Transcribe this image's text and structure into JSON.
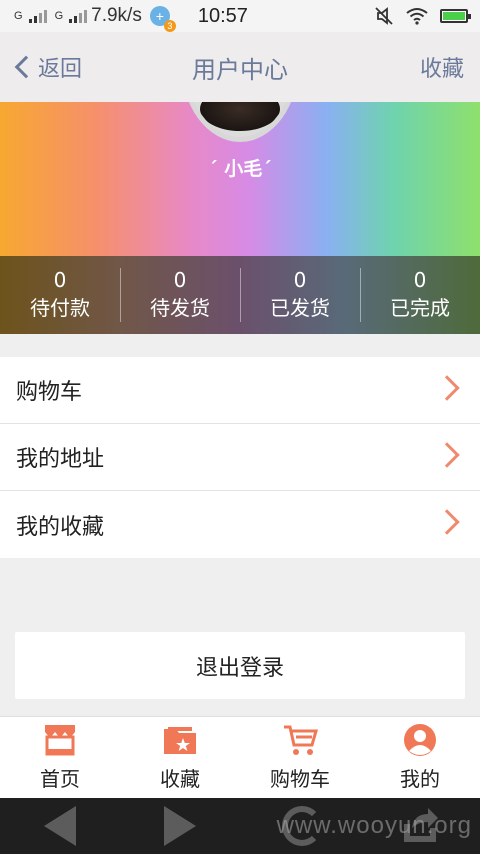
{
  "status_bar": {
    "sim1_label": "G",
    "sim2_label": "G",
    "net_speed": "7.9k/s",
    "qq_badge_count": "3",
    "time": "10:57"
  },
  "header": {
    "back_label": "返回",
    "title": "用户中心",
    "favorite_label": "收藏"
  },
  "profile": {
    "username": "´ 小毛´"
  },
  "order_stats": [
    {
      "count": "0",
      "label": "待付款"
    },
    {
      "count": "0",
      "label": "待发货"
    },
    {
      "count": "0",
      "label": "已发货"
    },
    {
      "count": "0",
      "label": "已完成"
    }
  ],
  "menu": [
    {
      "label": "购物车"
    },
    {
      "label": "我的地址"
    },
    {
      "label": "我的收藏"
    }
  ],
  "logout_label": "退出登录",
  "tabs": [
    {
      "label": "首页",
      "icon": "store-icon"
    },
    {
      "label": "收藏",
      "icon": "folder-star-icon"
    },
    {
      "label": "购物车",
      "icon": "cart-icon"
    },
    {
      "label": "我的",
      "icon": "user-icon"
    }
  ],
  "watermark": "www.wooyun.org",
  "colors": {
    "accent": "#f08a6e",
    "header_text": "#6b7a9b"
  }
}
